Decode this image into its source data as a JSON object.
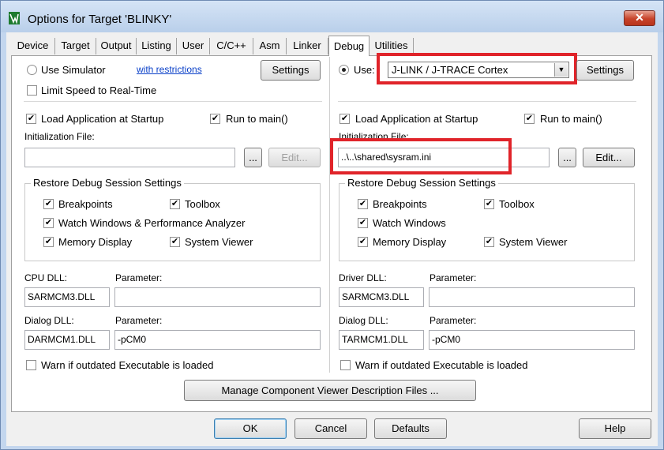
{
  "window": {
    "title": "Options for Target 'BLINKY'",
    "close_glyph": "✕"
  },
  "tabs": [
    {
      "label": "Device"
    },
    {
      "label": "Target"
    },
    {
      "label": "Output"
    },
    {
      "label": "Listing"
    },
    {
      "label": "User"
    },
    {
      "label": "C/C++"
    },
    {
      "label": "Asm"
    },
    {
      "label": "Linker"
    },
    {
      "label": "Debug"
    },
    {
      "label": "Utilities"
    }
  ],
  "left": {
    "use_simulator": "Use Simulator",
    "with_restrictions": "with restrictions",
    "settings": "Settings",
    "limit_speed": "Limit Speed to Real-Time",
    "load_app": "Load Application at Startup",
    "run_to_main": "Run to main()",
    "init_file_label": "Initialization File:",
    "init_file_value": "",
    "browse": "...",
    "edit": "Edit...",
    "restore_title": "Restore Debug Session Settings",
    "breakpoints": "Breakpoints",
    "toolbox": "Toolbox",
    "watch_windows": "Watch Windows & Performance Analyzer",
    "memory_display": "Memory Display",
    "system_viewer": "System Viewer",
    "cpu_dll_label": "CPU DLL:",
    "cpu_dll_value": "SARMCM3.DLL",
    "cpu_param_label": "Parameter:",
    "cpu_param_value": "",
    "dialog_dll_label": "Dialog DLL:",
    "dialog_dll_value": "DARMCM1.DLL",
    "dialog_param_label": "Parameter:",
    "dialog_param_value": "-pCM0",
    "warn_outdated": "Warn if outdated Executable is loaded"
  },
  "right": {
    "use": "Use:",
    "debugger": "J-LINK / J-TRACE Cortex",
    "settings": "Settings",
    "load_app": "Load Application at Startup",
    "run_to_main": "Run to main()",
    "init_file_label": "Initialization File:",
    "init_file_value": "..\\..\\shared\\sysram.ini",
    "browse": "...",
    "edit": "Edit...",
    "restore_title": "Restore Debug Session Settings",
    "breakpoints": "Breakpoints",
    "toolbox": "Toolbox",
    "watch_windows": "Watch Windows",
    "memory_display": "Memory Display",
    "system_viewer": "System Viewer",
    "driver_dll_label": "Driver DLL:",
    "driver_dll_value": "SARMCM3.DLL",
    "driver_param_label": "Parameter:",
    "driver_param_value": "",
    "dialog_dll_label": "Dialog DLL:",
    "dialog_dll_value": "TARMCM1.DLL",
    "dialog_param_label": "Parameter:",
    "dialog_param_value": "-pCM0",
    "warn_outdated": "Warn if outdated Executable is loaded"
  },
  "manage_component": "Manage Component Viewer Description Files ...",
  "footer": {
    "ok": "OK",
    "cancel": "Cancel",
    "defaults": "Defaults",
    "help": "Help"
  },
  "check_glyph": "✔",
  "colors": {
    "highlight": "#e0242a",
    "link": "#0a40c8"
  }
}
